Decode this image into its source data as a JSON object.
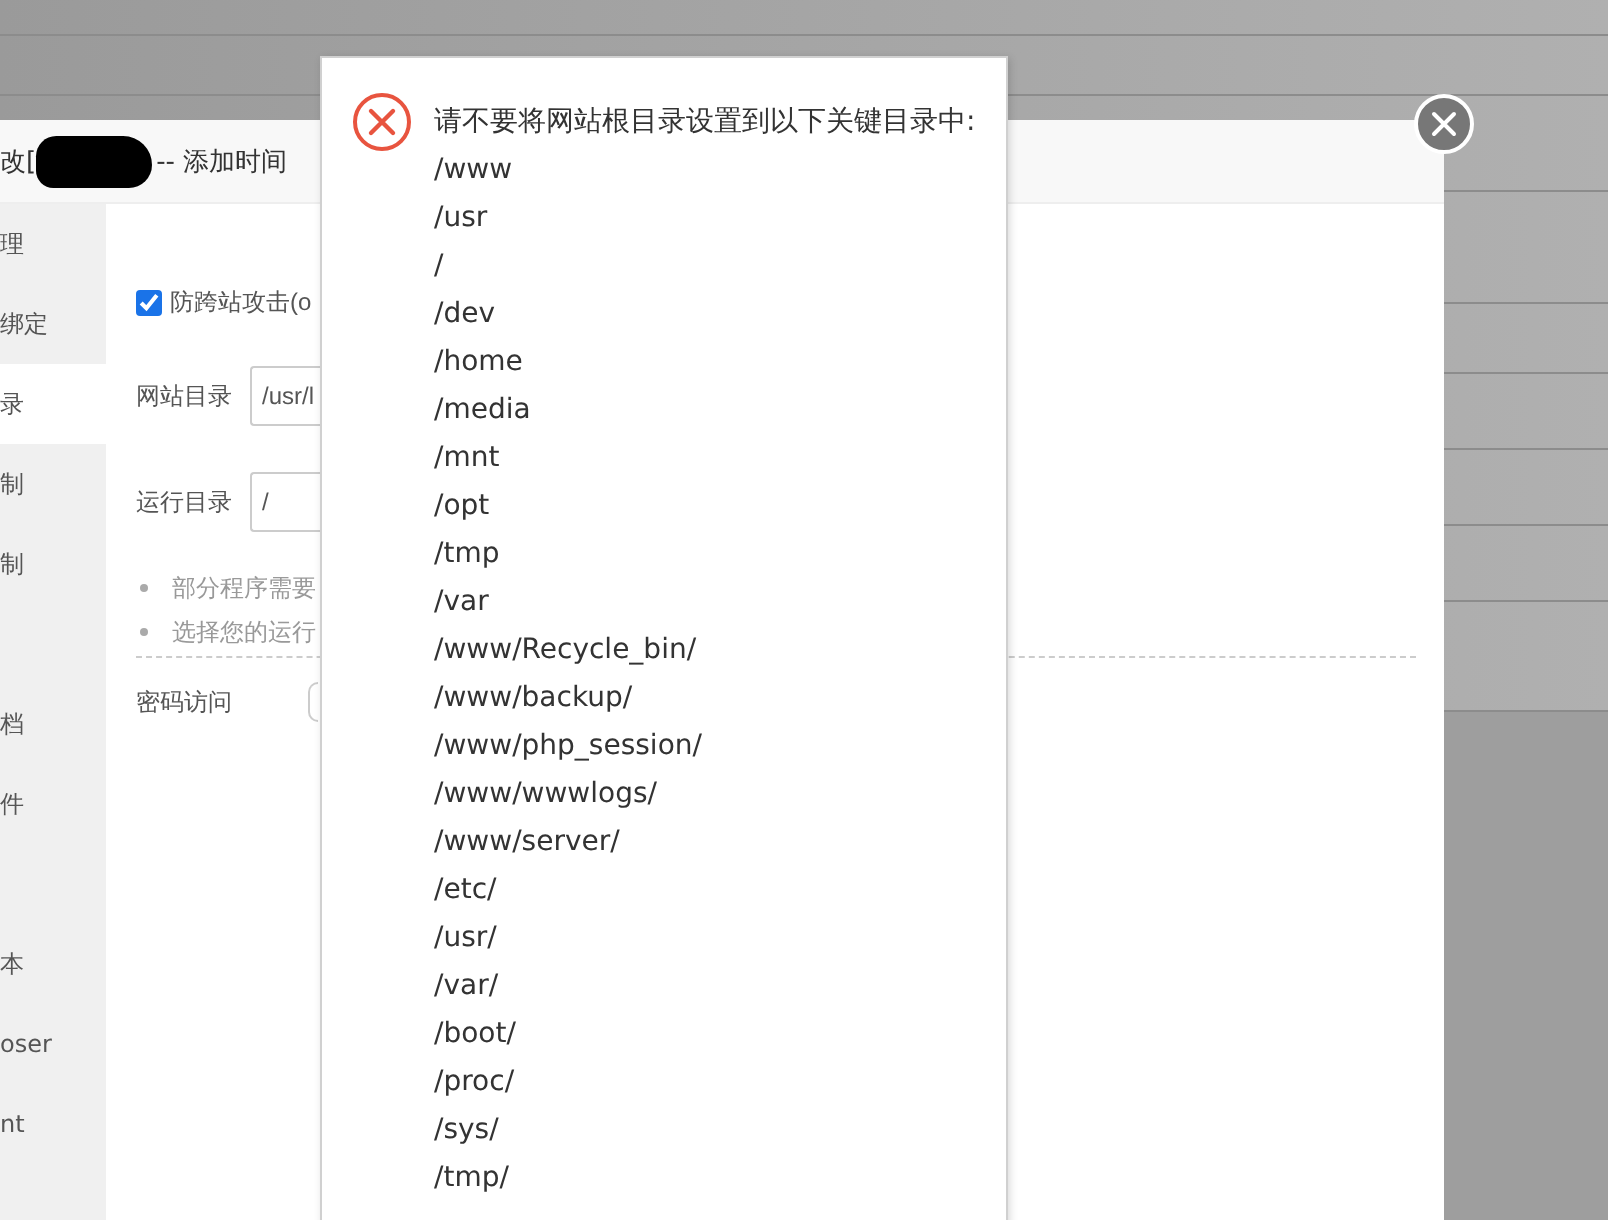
{
  "dialog": {
    "title_prefix": "改[",
    "title_suffix": "-- 添加时间"
  },
  "sidebar": {
    "groups": [
      {
        "items": [
          {
            "label": "理",
            "selected": false
          },
          {
            "label": "绑定",
            "selected": false
          },
          {
            "label": "录",
            "selected": true
          },
          {
            "label": "制",
            "selected": false
          },
          {
            "label": "制",
            "selected": false
          }
        ]
      },
      {
        "items": [
          {
            "label": "档",
            "selected": false
          },
          {
            "label": "件",
            "selected": false
          }
        ]
      },
      {
        "items": [
          {
            "label": "本",
            "selected": false
          },
          {
            "label": "oser",
            "selected": false
          },
          {
            "label": "nt",
            "selected": false
          }
        ]
      }
    ]
  },
  "form": {
    "anti_xss": {
      "label": "防跨站攻击(o",
      "checked": true
    },
    "fields": [
      {
        "label": "网站目录",
        "value": "/usr/l"
      },
      {
        "label": "运行目录",
        "value": "/"
      }
    ],
    "notes": [
      "部分程序需要",
      "选择您的运行"
    ],
    "password_access": {
      "label": "密码访问",
      "on": false
    }
  },
  "alert": {
    "message": "请不要将网站根目录设置到以下关键目录中:",
    "paths": [
      "/www",
      "/usr",
      "/",
      "/dev",
      "/home",
      "/media",
      "/mnt",
      "/opt",
      "/tmp",
      "/var",
      "/www/Recycle_bin/",
      "/www/backup/",
      "/www/php_session/",
      "/www/wwwlogs/",
      "/www/server/",
      "/etc/",
      "/usr/",
      "/var/",
      "/boot/",
      "/proc/",
      "/sys/",
      "/tmp/"
    ]
  }
}
